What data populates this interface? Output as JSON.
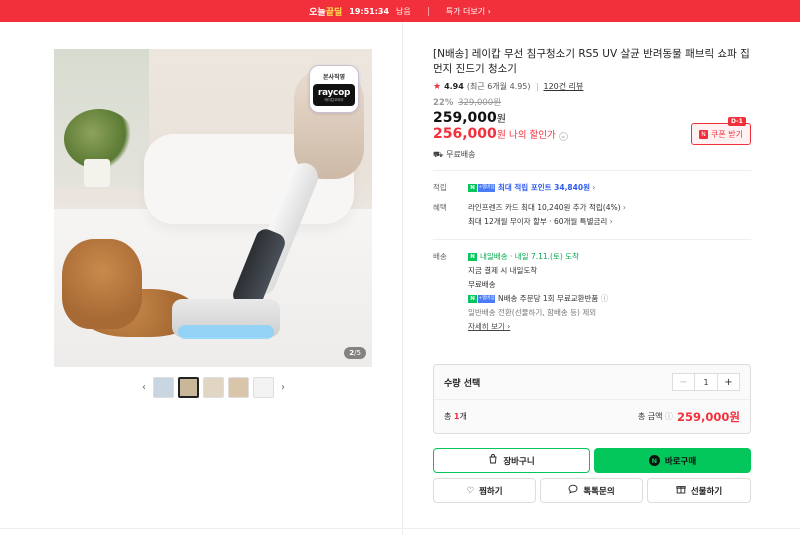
{
  "banner": {
    "brand_a": "오늘",
    "brand_b": "끝딜",
    "timer": "19:51:34",
    "timer_suffix": "남음",
    "more": "특가 더보기",
    "bg_color": "#f2303b"
  },
  "gallery": {
    "official_badge": "본사직영",
    "logo_text": "raycop",
    "logo_sub": "레이캅코리아",
    "page_current": "2",
    "page_total": "5",
    "thumbnails": [
      {
        "color": "#c9d6e2"
      },
      {
        "color": "#c9b79a"
      },
      {
        "color": "#e1d5c4"
      },
      {
        "color": "#d9c6aa"
      },
      {
        "color": "#f3f3f3"
      }
    ]
  },
  "product": {
    "title": "[N배송] 레이캅 무선 침구청소기 RS5 UV 살균 반려동물 패브릭 쇼파 집먼지 진드기 청소기",
    "rating": "4.94",
    "rating_detail": "(최근 6개월 4.95)",
    "review_count": "120건 리뷰",
    "discount_pct": "22%",
    "original_price": "329,000원",
    "price": "259,000",
    "price_unit": "원",
    "my_price": "256,000",
    "my_price_unit": "원",
    "my_price_label": "나의 할인가",
    "coupon_label": "쿠폰 받기",
    "coupon_dday": "D-1",
    "free_shipping": "무료배송"
  },
  "benefits": {
    "points_label": "적립",
    "points_text": "최대 적립 포인트 34,840원",
    "benefit_label": "혜택",
    "benefit_line1": "라인프렌즈 카드 최대 10,240원 추가 적립(4%)",
    "benefit_line2": "최대 12개월 무이자 할부 · 60개월 특별금리"
  },
  "delivery": {
    "label": "배송",
    "npay_tag": "내일배송",
    "arrival": "· 내일 7.11.(토) 도착",
    "line2": "지금 결제 시 내일도착",
    "line3": "무료배송",
    "line4": "N배송 주문당 1회 무료교환반품",
    "line5": "일반배송 전환(선물하기, 함배송 등) 제외",
    "details": "자세히 보기"
  },
  "quantity": {
    "label": "수량 선택",
    "minus": "−",
    "value": "1",
    "plus": "+",
    "total_prefix": "총",
    "total_count": "1",
    "total_suffix": "개",
    "total_label": "총 금액",
    "total_price": "259,000원"
  },
  "actions": {
    "cart": "장바구니",
    "buy": "바로구매",
    "wish": "찜하기",
    "talk": "톡톡문의",
    "gift": "선물하기"
  }
}
